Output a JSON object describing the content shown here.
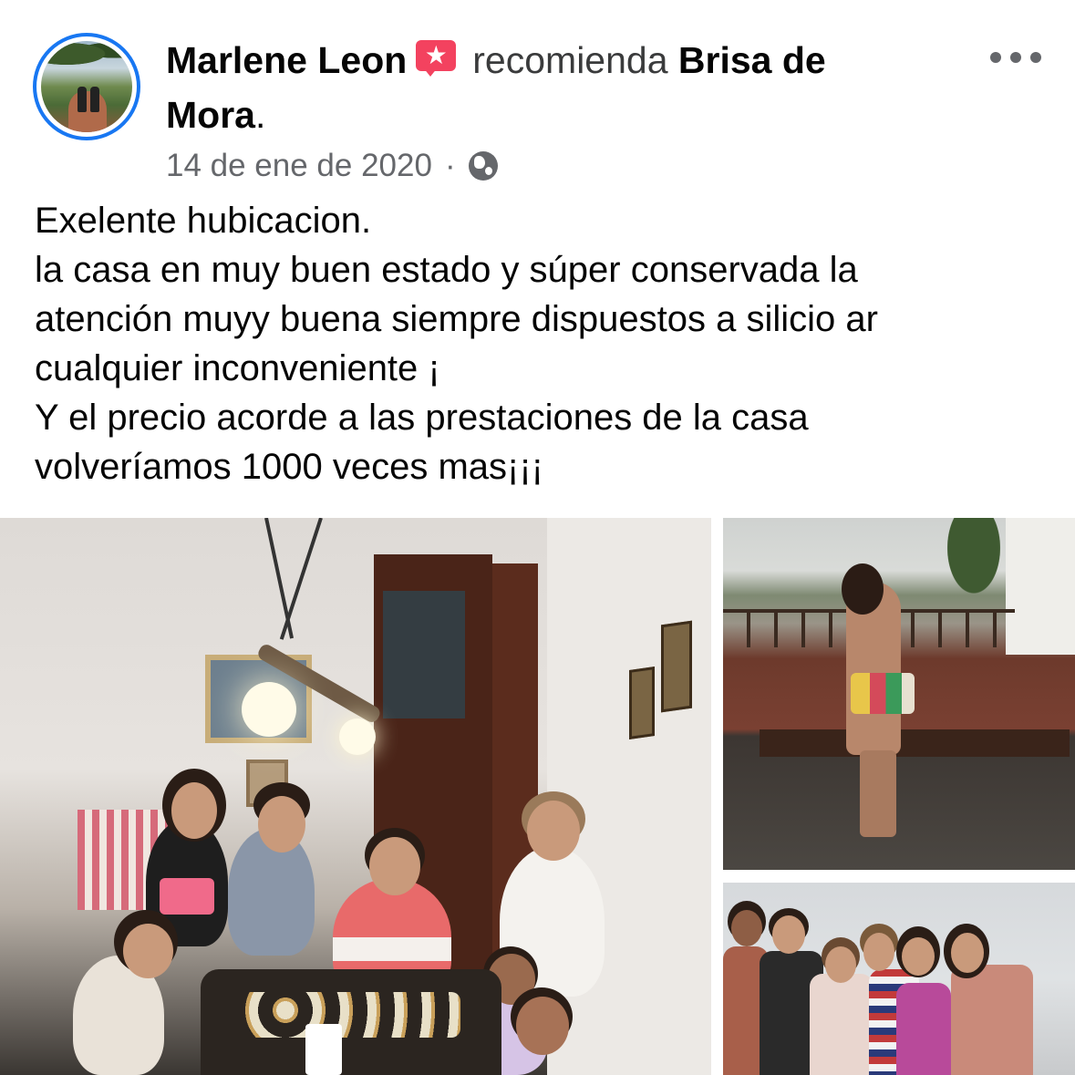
{
  "post": {
    "author": "Marlene Leon",
    "action": "recomienda",
    "page_name": "Brisa de",
    "page_name_line2": "Mora",
    "period": ".",
    "timestamp": "14 de ene de 2020",
    "separator": "·",
    "privacy_icon": "globe-icon",
    "recommend_icon": "recommend-star-icon",
    "more_icon": "more-options-icon",
    "body_lines": [
      "Exelente hubicacion.",
      "la casa en muy buen estado y súper conservada la",
      "atención muyy buena siempre dispuestos a silicio ar",
      "cualquier inconveniente ¡",
      "Y el precio acorde a las prestaciones de la casa",
      "volveríamos 1000 veces mas¡¡¡"
    ]
  },
  "colors": {
    "accent_blue": "#1877f2",
    "recommend_red": "#f3425f",
    "secondary_text": "#65676b",
    "primary_text": "#050505"
  },
  "photos": [
    {
      "name": "group-dinner-photo"
    },
    {
      "name": "terrace-photo"
    },
    {
      "name": "beach-group-photo"
    }
  ]
}
